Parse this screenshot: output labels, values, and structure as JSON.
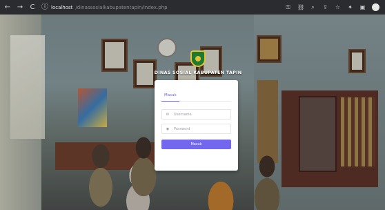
{
  "browser": {
    "url_host": "localhost",
    "url_path": "/dinassosialkabupatentapin/index.php",
    "nav": {
      "back": "←",
      "forward": "→",
      "reload": "C"
    },
    "icons": [
      "key-icon",
      "extension-icon",
      "zoom-icon",
      "share-icon",
      "star-icon",
      "puzzle-icon",
      "sidebar-icon",
      "profile-icon"
    ]
  },
  "brand": {
    "title": "DINAS SOSIAL KABUPATEN TAPIN"
  },
  "login": {
    "tab_label": "Masuk",
    "username_placeholder": "Username",
    "password_placeholder": "Password",
    "submit_label": "Masuk"
  },
  "colors": {
    "accent": "#7367f0",
    "chrome_bg": "#2b2c30"
  }
}
